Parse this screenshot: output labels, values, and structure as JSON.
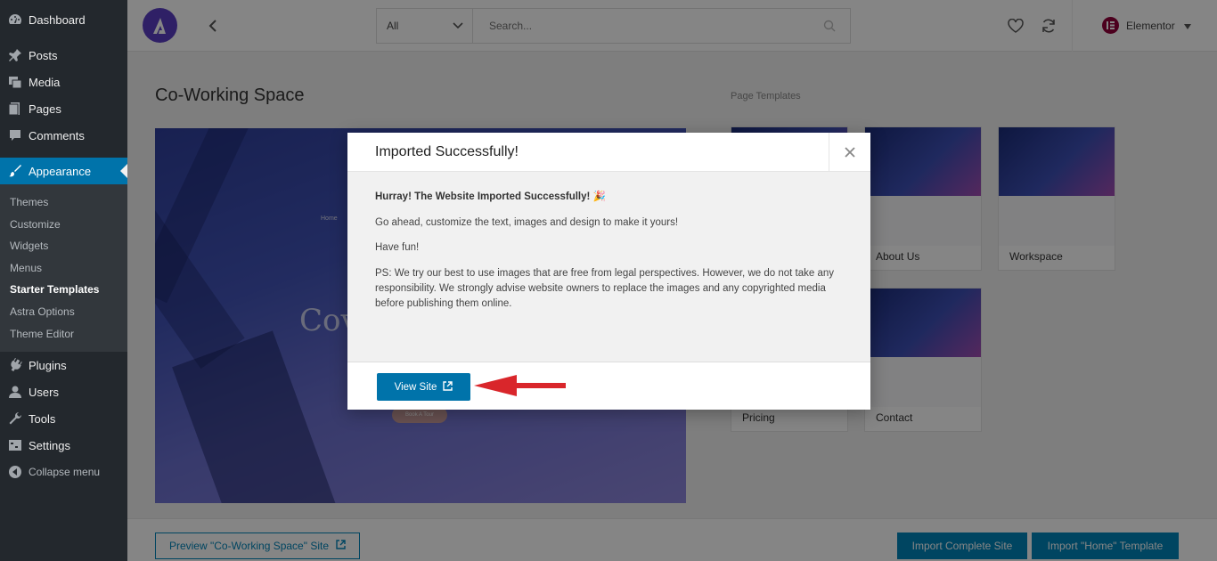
{
  "sidebar": {
    "items": [
      {
        "label": "Dashboard",
        "icon": "dashboard-icon"
      },
      {
        "label": "Posts",
        "icon": "pin-icon"
      },
      {
        "label": "Media",
        "icon": "media-icon"
      },
      {
        "label": "Pages",
        "icon": "pages-icon"
      },
      {
        "label": "Comments",
        "icon": "comment-icon"
      },
      {
        "label": "Appearance",
        "icon": "brush-icon"
      }
    ],
    "appearance_submenu": [
      "Themes",
      "Customize",
      "Widgets",
      "Menus",
      "Starter Templates",
      "Astra Options",
      "Theme Editor"
    ],
    "bottom_items": [
      {
        "label": "Plugins",
        "icon": "plugin-icon"
      },
      {
        "label": "Users",
        "icon": "user-icon"
      },
      {
        "label": "Tools",
        "icon": "wrench-icon"
      },
      {
        "label": "Settings",
        "icon": "settings-icon"
      }
    ],
    "collapse_label": "Collapse menu"
  },
  "topbar": {
    "filter_value": "All",
    "search_placeholder": "Search...",
    "page_builder": "Elementor"
  },
  "main": {
    "title": "Co-Working Space",
    "preview_nav": "Home",
    "preview_hero": "Cov",
    "preview_button": "Book A Tour"
  },
  "templates": {
    "label": "Page Templates",
    "cards": [
      "About Us",
      "Workspace",
      "Pricing",
      "Contact"
    ]
  },
  "bottombar": {
    "preview_label": "Preview \"Co-Working Space\" Site",
    "import_site_label": "Import Complete Site",
    "import_template_label": "Import \"Home\" Template"
  },
  "modal": {
    "title": "Imported Successfully!",
    "lead": "Hurray! The Website Imported Successfully! 🎉",
    "line1": "Go ahead, customize the text, images and design to make it yours!",
    "line2": "Have fun!",
    "ps": "PS: We try our best to use images that are free from legal perspectives. However, we do not take any responsibility. We strongly advise website owners to replace the images and any copyrighted media before publishing them online.",
    "button_label": "View Site"
  },
  "colors": {
    "sidebar_bg": "#23282d",
    "accent": "#0073aa",
    "arrow": "#d9262b"
  }
}
